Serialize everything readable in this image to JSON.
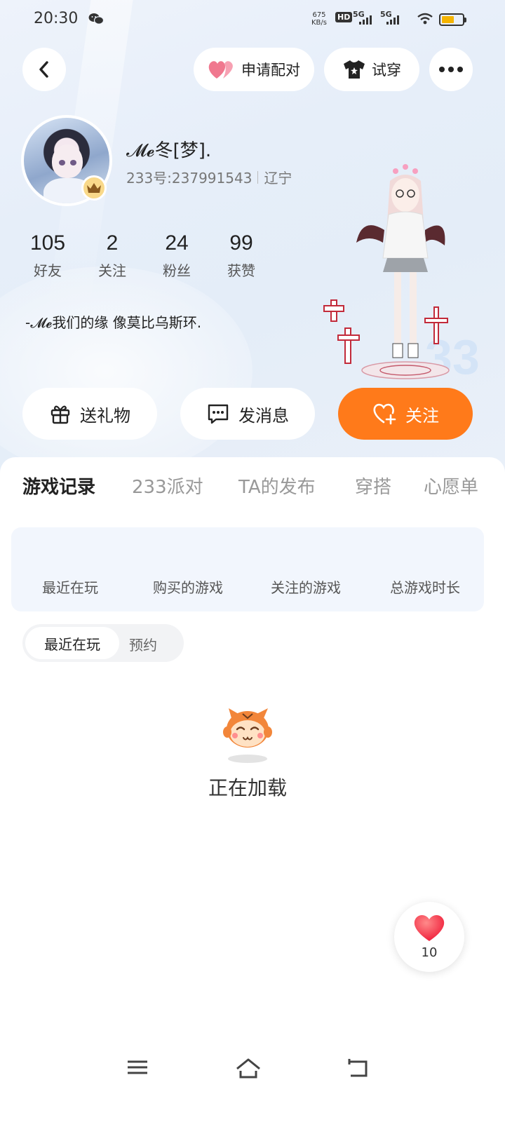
{
  "status_bar": {
    "time": "20:30",
    "net_speed_value": "675",
    "net_speed_unit": "KB/s",
    "hd_label": "HD",
    "sim1_label": "5G",
    "sim2_label": "5G",
    "battery_level": 0.55,
    "battery_color": "#f5b400"
  },
  "top_bar": {
    "match_label": "申请配对",
    "tryon_label": "试穿"
  },
  "profile": {
    "nickname": "𝓜𝓮冬[梦].",
    "uid": "233号:237991543",
    "region": "辽宁",
    "bio": "-𝓜𝓮我们的缘 像莫比乌斯环."
  },
  "stats": [
    {
      "value": "105",
      "label": "好友"
    },
    {
      "value": "2",
      "label": "关注"
    },
    {
      "value": "24",
      "label": "粉丝"
    },
    {
      "value": "99",
      "label": "获赞"
    }
  ],
  "actions": {
    "gift_label": "送礼物",
    "message_label": "发消息",
    "follow_label": "关注",
    "accent_color": "#ff7a1a"
  },
  "tabs": [
    {
      "label": "游戏记录",
      "active": true
    },
    {
      "label": "233派对",
      "active": false
    },
    {
      "label": "TA的发布",
      "active": false
    },
    {
      "label": "穿搭",
      "active": false
    },
    {
      "label": "心愿单",
      "active": false
    }
  ],
  "game_summary": [
    "最近在玩",
    "购买的游戏",
    "关注的游戏",
    "总游戏时长"
  ],
  "segment": {
    "active_label": "最近在玩",
    "inactive_label": "预约"
  },
  "loading_text": "正在加载",
  "like_fab": {
    "count": "10"
  },
  "icons": [
    "back-icon",
    "heart-icon",
    "tshirt-icon",
    "more-icon",
    "wechat-icon",
    "wifi-icon",
    "crown-icon",
    "gift-icon",
    "chat-icon",
    "heart-plus-icon",
    "menu-icon",
    "home-icon",
    "return-icon"
  ]
}
